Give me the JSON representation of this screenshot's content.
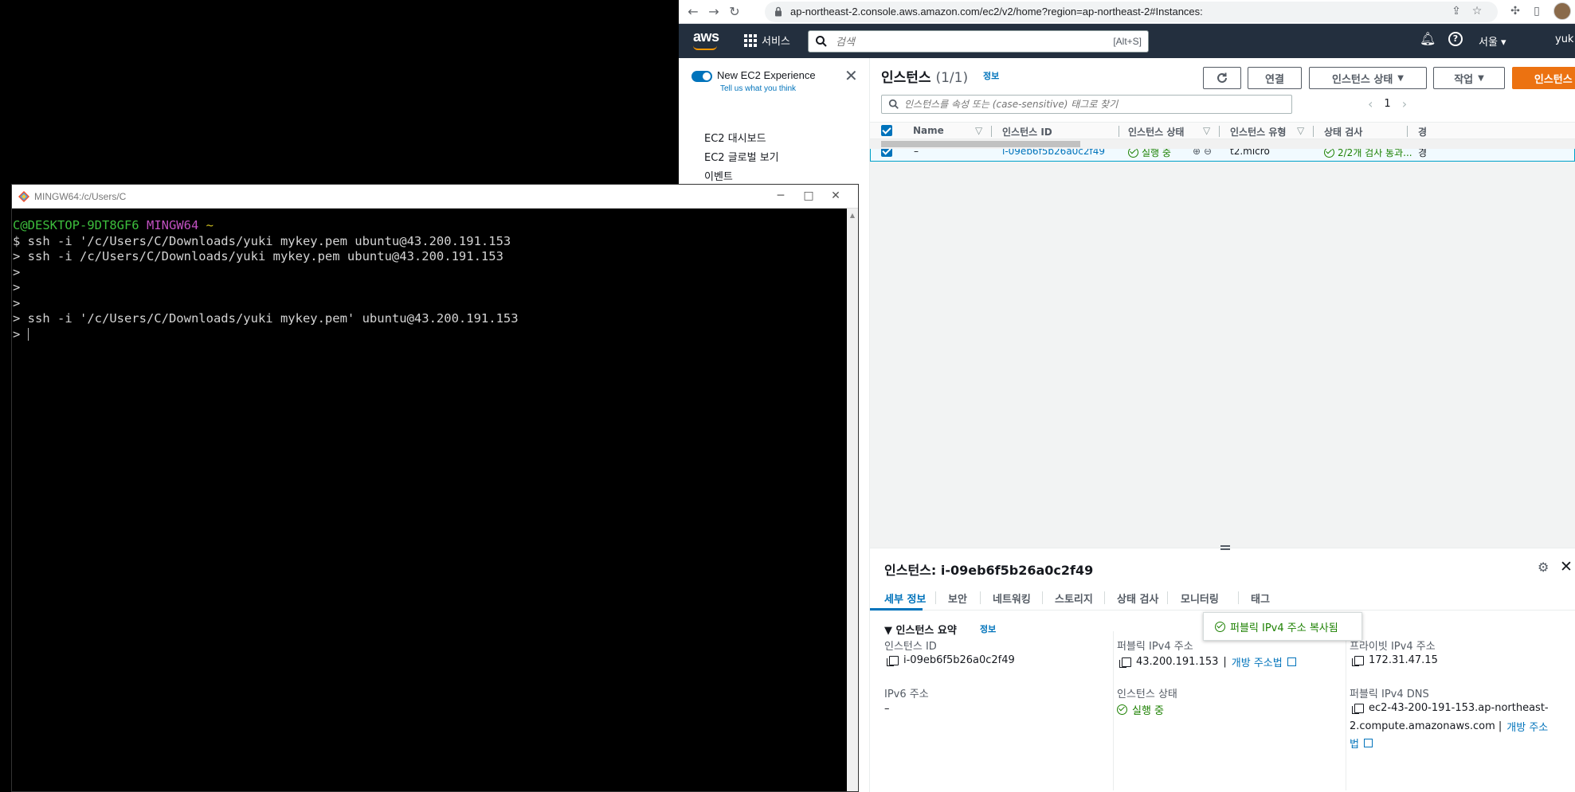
{
  "browser": {
    "url": "ap-northeast-2.console.aws.amazon.com/ec2/v2/home?region=ap-northeast-2#Instances:"
  },
  "aws_nav": {
    "logo": "aws",
    "services_label": "서비스",
    "search_placeholder": "검색",
    "search_shortcut": "[Alt+S]",
    "region": "서울 ▾",
    "user": "yuk"
  },
  "side": {
    "new_exp_label": "New EC2 Experience",
    "new_exp_link": "Tell us what you think",
    "items": [
      "EC2 대시보드",
      "EC2 글로벌 보기",
      "이벤트"
    ]
  },
  "instances": {
    "title": "인스턴스",
    "count": "(1/1)",
    "info": "정보",
    "buttons": {
      "connect": "연결",
      "state": "인스턴스 상태",
      "actions": "작업",
      "launch": "인스턴스 시작"
    },
    "filter_placeholder": "인스턴스를 속성 또는 (case-sensitive) 태그로 찾기",
    "page": "1",
    "columns": [
      "Name",
      "인스턴스 ID",
      "인스턴스 상태",
      "인스턴스 유형",
      "상태 검사",
      "경"
    ],
    "row": {
      "name": "–",
      "id": "i-09eb6f5b26a0c2f49",
      "state": "실행 중",
      "type": "t2.micro",
      "check": "2/2개 검사 통과...",
      "extra": "경"
    }
  },
  "detail": {
    "title": "인스턴스: i-09eb6f5b26a0c2f49",
    "tabs": [
      "세부 정보",
      "보안",
      "네트워킹",
      "스토리지",
      "상태 검사",
      "모니터링",
      "태그"
    ],
    "summary": "인스턴스 요약",
    "summary_info": "정보",
    "toast": "퍼블릭 IPv4 주소 복사됨",
    "fields": {
      "instance_id_label": "인스턴스 ID",
      "instance_id": "i-09eb6f5b26a0c2f49",
      "public_ip_label": "퍼블릭 IPv4 주소",
      "public_ip": "43.200.191.153",
      "open_address": "개방 주소법",
      "private_ip_label": "프라이빗 IPv4 주소",
      "private_ip": "172.31.47.15",
      "ipv6_label": "IPv6 주소",
      "ipv6": "–",
      "state_label": "인스턴스 상태",
      "state": "실행 중",
      "public_dns_label": "퍼블릭 IPv4 DNS",
      "public_dns_1": "ec2-43-200-191-153.ap-northeast-",
      "public_dns_2": "2.compute.amazonaws.com |",
      "public_dns_link_1": "개방 주소",
      "public_dns_link_2": "법"
    }
  },
  "terminal": {
    "title": "MINGW64:/c/Users/C",
    "prompt_user": "C@DESKTOP-9DT8GF6",
    "prompt_env": "MINGW64",
    "prompt_dir": "~",
    "lines": [
      "$ ssh -i '/c/Users/C/Downloads/yuki mykey.pem ubuntu@43.200.191.153",
      "> ssh -i /c/Users/C/Downloads/yuki mykey.pem ubuntu@43.200.191.153",
      ">",
      ">",
      ">",
      "> ssh -i '/c/Users/C/Downloads/yuki mykey.pem' ubuntu@43.200.191.153",
      "> "
    ]
  },
  "colors": {
    "aws_nav": "#232f3e",
    "aws_orange": "#ec7211",
    "link_blue": "#0073bb",
    "success_green": "#1d8102",
    "terminal_green": "#3dbf3d",
    "terminal_magenta": "#c050c0",
    "terminal_yellow": "#d0c020"
  }
}
